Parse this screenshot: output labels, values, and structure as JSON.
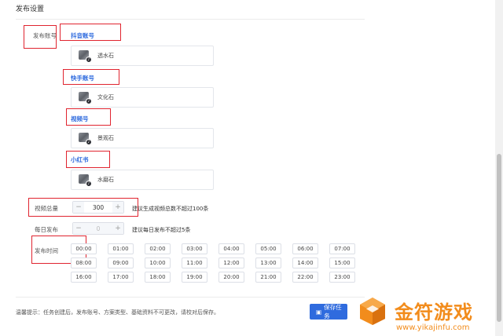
{
  "page": {
    "title": "发布设置"
  },
  "publish_account": {
    "label": "发布账号",
    "platforms": [
      {
        "name": "抖音账号",
        "account": "透水石"
      },
      {
        "name": "快手账号",
        "account": "文化石"
      },
      {
        "name": "视频号",
        "account": "景观石"
      },
      {
        "name": "小红书",
        "account": "水磨石"
      }
    ]
  },
  "video_total": {
    "label": "视频总量",
    "value": "300",
    "minus": "−",
    "plus": "+",
    "hint": "建议生成视频总数不超过100条"
  },
  "daily_publish": {
    "label": "每日发布",
    "value": "0",
    "minus": "−",
    "plus": "+",
    "hint": "建议每日发布不超过5条"
  },
  "publish_time": {
    "label": "发布时间",
    "times": [
      "00:00",
      "01:00",
      "02:00",
      "03:00",
      "04:00",
      "05:00",
      "06:00",
      "07:00",
      "08:00",
      "09:00",
      "10:00",
      "11:00",
      "12:00",
      "13:00",
      "14:00",
      "15:00",
      "16:00",
      "17:00",
      "18:00",
      "19:00",
      "20:00",
      "21:00",
      "22:00",
      "23:00"
    ]
  },
  "footer": {
    "tip": "温馨提示：任务创建后，发布账号、方案类型、基础资料不可更改，请校对后保存。",
    "save_label": "保存任务"
  },
  "watermark": {
    "text": "金符游戏",
    "url": "www.yikajinfu.com"
  }
}
